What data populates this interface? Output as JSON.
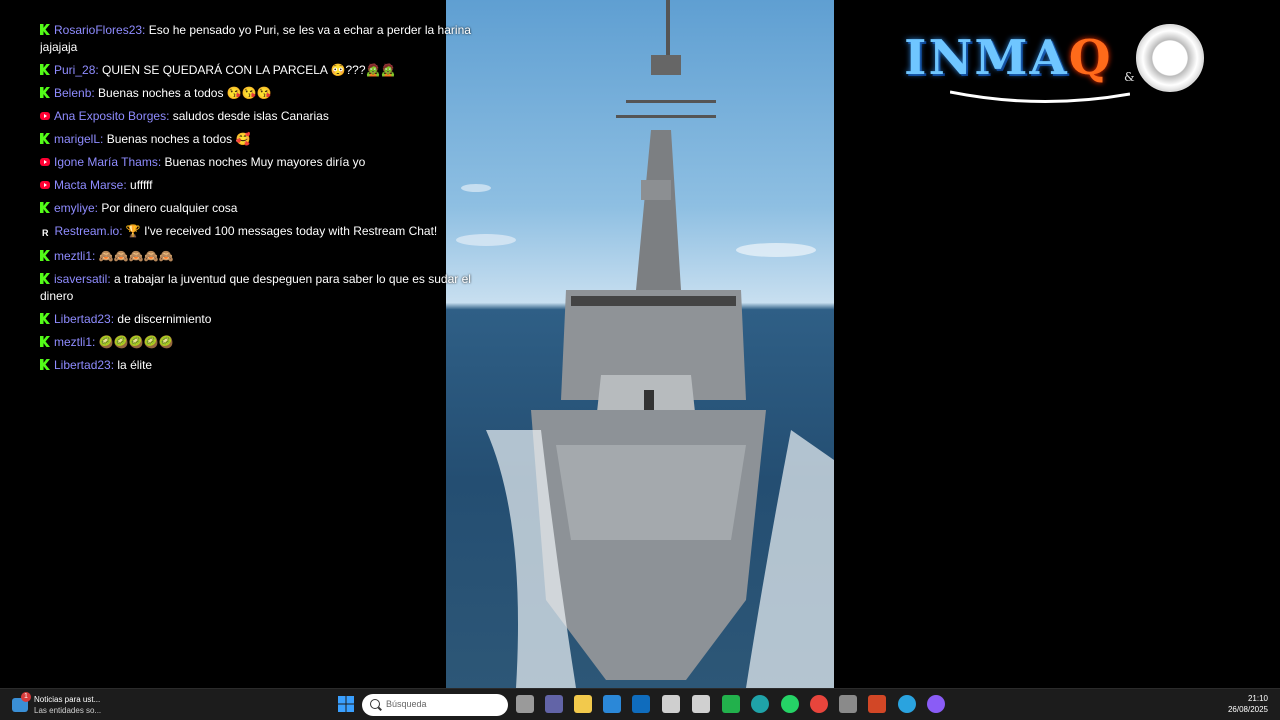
{
  "chat": {
    "messages": [
      {
        "platform": "kick",
        "user": "RosarioFlores23:",
        "text": "Eso he pensado yo Puri, se les va a echar a perder la harina jajajaja"
      },
      {
        "platform": "kick",
        "user": "Puri_28:",
        "text": "QUIEN SE QUEDARÁ CON LA PARCELA 😳???🧟🧟"
      },
      {
        "platform": "kick",
        "user": "Belenb:",
        "text": "Buenas noches a todos 😘😘😘"
      },
      {
        "platform": "youtube",
        "user": "Ana Exposito Borges:",
        "text": "saludos desde islas Canarias"
      },
      {
        "platform": "kick",
        "user": "marigelL:",
        "text": "Buenas noches a todos 🥰"
      },
      {
        "platform": "youtube",
        "user": "Igone María Thams:",
        "text": "Buenas noches Muy mayores diría yo"
      },
      {
        "platform": "youtube",
        "user": "Macta Marse:",
        "text": "ufffff"
      },
      {
        "platform": "kick",
        "user": "emyliye:",
        "text": "Por dinero cualquier cosa"
      },
      {
        "platform": "restream",
        "user": "Restream.io:",
        "text": "🏆 I've received 100 messages today with Restream Chat!"
      },
      {
        "platform": "kick",
        "user": "meztli1:",
        "text": "🙈🙈🙈🙈🙈"
      },
      {
        "platform": "kick",
        "user": "isaversatil:",
        "text": "a trabajar la juventud que despeguen para saber lo que es sudar el dinero"
      },
      {
        "platform": "kick",
        "user": "Libertad23:",
        "text": "de discernimiento"
      },
      {
        "platform": "kick",
        "user": "meztli1:",
        "text": "🥝🥝🥝🥝🥝"
      },
      {
        "platform": "kick",
        "user": "Libertad23:",
        "text": "la élite"
      }
    ]
  },
  "logo": {
    "word_main": "INMA",
    "word_q": "Q",
    "amp": "&"
  },
  "taskbar": {
    "news_title": "Noticias para ust...",
    "news_sub": "Las entidades so...",
    "news_count": "1",
    "search_placeholder": "Búsqueda",
    "time": "21:10",
    "date": "26/08/2025",
    "icons": [
      {
        "name": "windows-start-icon",
        "color": "#3aa0ff"
      },
      {
        "name": "task-view-icon",
        "color": "#9a9a9a"
      },
      {
        "name": "teams-icon",
        "color": "#6264a7"
      },
      {
        "name": "file-explorer-icon",
        "color": "#f2c94c"
      },
      {
        "name": "microsoft-store-icon",
        "color": "#2b88d8"
      },
      {
        "name": "outlook-icon",
        "color": "#0f6cbd"
      },
      {
        "name": "app-spiral-icon",
        "color": "#cfcfcf"
      },
      {
        "name": "app-hexagon-icon",
        "color": "#d0d0d0"
      },
      {
        "name": "camtasia-icon",
        "color": "#22b14c"
      },
      {
        "name": "edge-icon",
        "color": "#1fa3a8"
      },
      {
        "name": "whatsapp-icon",
        "color": "#25d366"
      },
      {
        "name": "chrome-icon",
        "color": "#e8453c"
      },
      {
        "name": "app-gray-icon",
        "color": "#8a8a8a"
      },
      {
        "name": "powerpoint-icon",
        "color": "#d24726"
      },
      {
        "name": "telegram-icon",
        "color": "#2aa3df"
      },
      {
        "name": "app-circle-icon",
        "color": "#8a5cf6"
      }
    ]
  }
}
